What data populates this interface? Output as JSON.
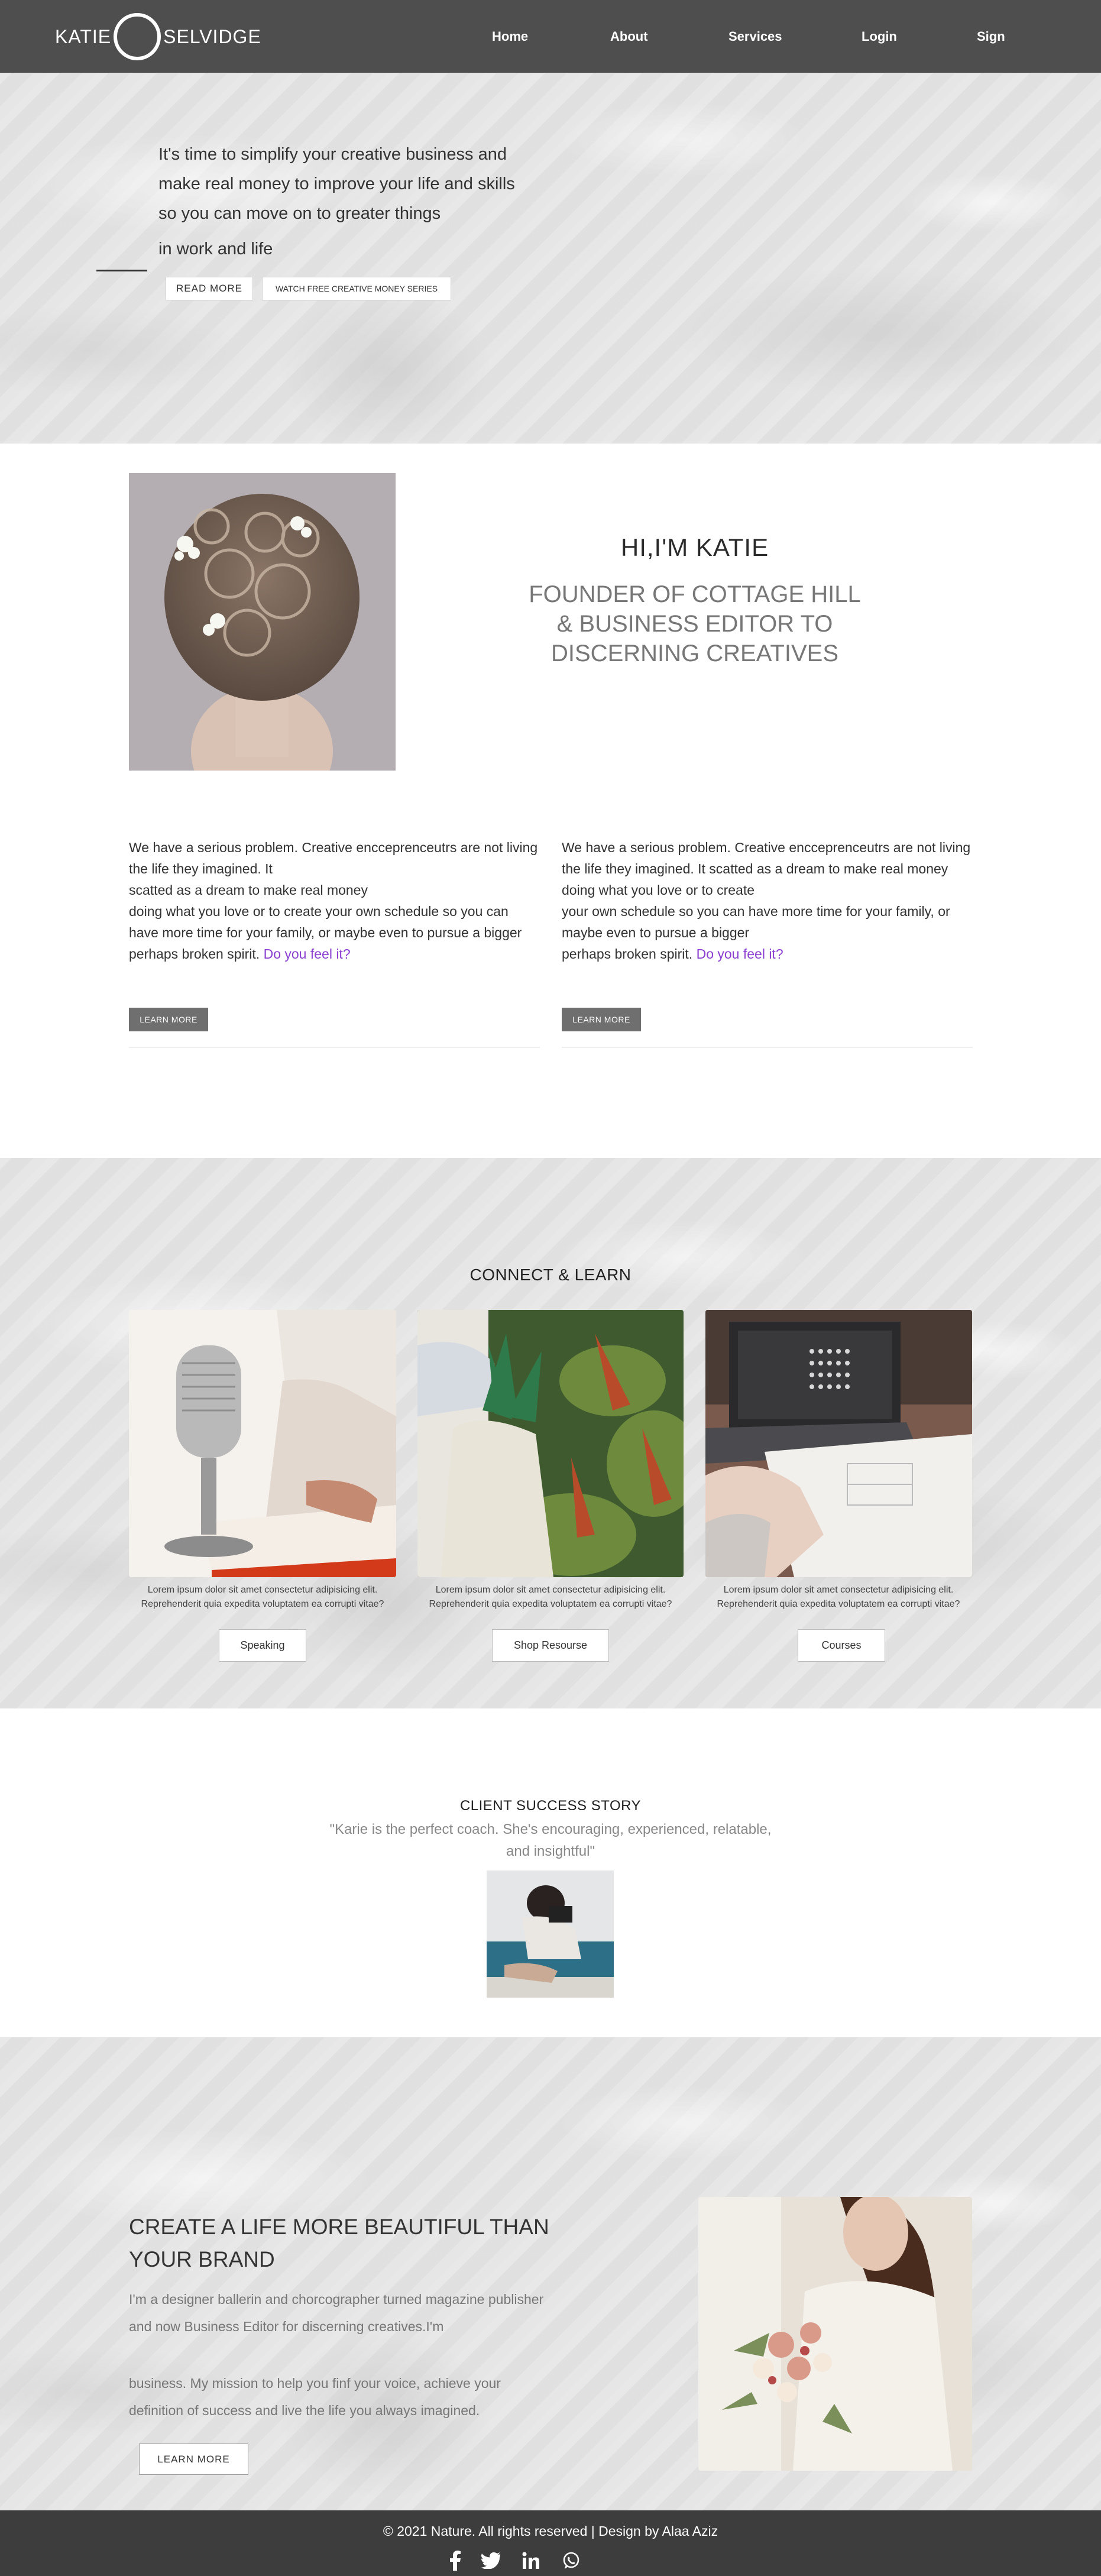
{
  "nav": {
    "logo_left": "KATIE",
    "logo_right": "SELVIDGE",
    "items": [
      "Home",
      "About",
      "Services",
      "Login",
      "Sign"
    ]
  },
  "hero": {
    "text": "It's time to simplify your creative business and make real money to improve your life and skills so you can move on to greater things",
    "text_last": "in work and life",
    "read_more": "READ MORE",
    "watch": "WATCH FREE CREATIVE MONEY SERIES"
  },
  "about": {
    "greeting": "HI,I'M KATIE",
    "subtitle": "FOUNDER OF COTTAGE HILL & BUSINESS EDITOR TO DISCERNING CREATIVES",
    "col1": {
      "lines": [
        "We have a serious problem. Creative encceprenceutrs are not living",
        "the life they imagined. It",
        "scatted as a dream to make real money",
        "doing what you love or to create your own schedule so you can have more time for your family, or maybe even to pursue a bigger",
        "perhaps broken spirit. "
      ],
      "highlight": "Do you feel it?",
      "button": "LEARN MORE"
    },
    "col2": {
      "lines": [
        "We have a serious problem. Creative encceprenceutrs are not living",
        "the life they imagined. It scatted as a dream to make real money",
        "doing what you love or to create",
        "your own schedule so you can have more time for your family, or",
        "maybe even to pursue a bigger",
        "perhaps broken spirit. "
      ],
      "highlight": "Do you feel it?",
      "button": "LEARN MORE"
    }
  },
  "connect": {
    "title": "CONNECT & LEARN",
    "cards": [
      {
        "desc": "Lorem ipsum dolor sit amet consectetur adipisicing elit. Reprehenderit quia expedita voluptatem ea corrupti vitae?",
        "button": "Speaking"
      },
      {
        "desc": "Lorem ipsum dolor sit amet consectetur adipisicing elit. Reprehenderit quia expedita voluptatem ea corrupti vitae?",
        "button": "Shop Resourse"
      },
      {
        "desc": "Lorem ipsum dolor sit amet consectetur adipisicing elit. Reprehenderit quia expedita voluptatem ea corrupti vitae?",
        "button": "Courses"
      }
    ]
  },
  "client": {
    "title": "CLIENT SUCCESS STORY",
    "quote": "\"Karie is the perfect coach. She's encouraging, experienced, relatable, and insightful\""
  },
  "create": {
    "heading": "CREATE A LIFE MORE BEAUTIFUL THAN YOUR BRAND",
    "p1": "I'm a designer ballerin and chorcographer turned magazine publisher and now Business Editor for discerning creatives.I'm",
    "p2": "business. My mission to help you finf your voice, achieve your definition of success and live the life you always imagined.",
    "button": "LEARN MORE"
  },
  "footer": {
    "text": "© 2021 Nature. All rights reserved | Design by Alaa Aziz",
    "social": [
      "facebook-icon",
      "twitter-icon",
      "linkedin-icon",
      "whatsapp-icon"
    ]
  },
  "colors": {
    "nav_bg": "#4e4e4e",
    "footer_bg": "#3d3d3d",
    "highlight": "#8a3fd1",
    "dark_button": "#6f6f6f"
  }
}
